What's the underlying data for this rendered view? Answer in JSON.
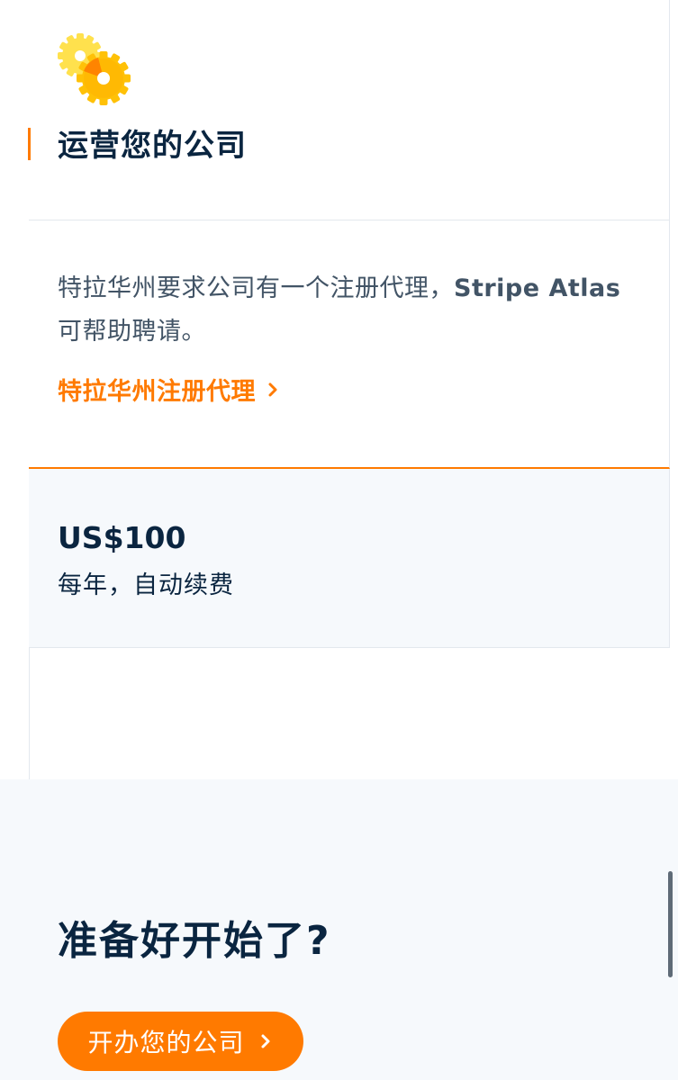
{
  "operate_card": {
    "title": "运营您的公司",
    "icon": "gears-icon"
  },
  "registered_agent_card": {
    "description_text": "特拉华州要求公司有一个注册代理，",
    "description_brand": "Stripe Atlas",
    "description_tail": "可帮助聘请。",
    "link_label": "特拉华州注册代理"
  },
  "price_card": {
    "price": "US$100",
    "note": "每年，自动续费"
  },
  "ready_section": {
    "title": "准备好开始了?",
    "cta_label": "开办您的公司"
  },
  "colors": {
    "accent": "#ff7a00",
    "heading": "#0a2540",
    "body_text": "#425466",
    "panel_bg": "#f6f9fc"
  }
}
